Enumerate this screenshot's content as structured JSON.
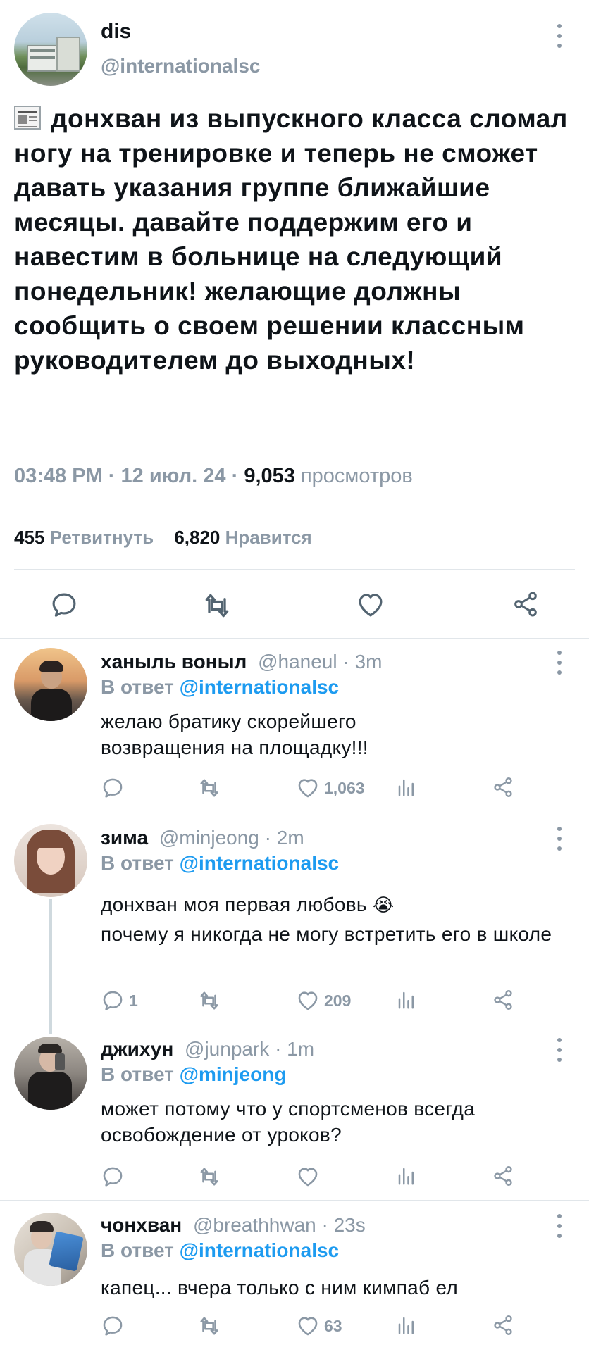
{
  "main_tweet": {
    "display_name": "dis",
    "handle": "@internationalsc",
    "text": "донхван из выпускного класса сломал ногу на тренировке и теперь не сможет давать указания группе ближайшие месяцы. давайте поддержим его и навестим в больнице на следующий понедельник! желающие должны сообщить о своем решении классным руководителем до выходных!",
    "time": "03:48 PM",
    "sep1": "·",
    "date": "12 июл. 24",
    "sep2": "·",
    "views": "9,053",
    "views_label": "просмотров",
    "retweets": "455",
    "retweets_label": "Ретвитнуть",
    "likes": "6,820",
    "likes_label": "Нравится",
    "icons": [
      "newspaper-emoji",
      "reply-icon",
      "retweet-icon",
      "like-icon",
      "share-icon"
    ]
  },
  "replies": [
    {
      "display_name": "ханыль воныл",
      "handle": "@haneul",
      "time": "· 3m",
      "reply_prefix": "В ответ",
      "reply_to": "@internationalsc",
      "text": "желаю братику скорейшего возвращения на площадку!!!",
      "reply_count": "",
      "like_count": "1,063"
    },
    {
      "display_name": "зима",
      "handle": "@minjeong",
      "time": "· 2m",
      "reply_prefix": "В ответ",
      "reply_to": "@internationalsc",
      "text_line1": "донхван моя первая любовь",
      "emoji": "😭",
      "text_line2": "почему я никогда не могу встретить его в школе",
      "reply_count": "1",
      "like_count": "209"
    },
    {
      "display_name": "джихун",
      "handle": "@junpark",
      "time": "· 1m",
      "reply_prefix": "В ответ",
      "reply_to": "@minjeong",
      "text": "может потому что у спортсменов всегда освобождение от уроков?",
      "reply_count": "",
      "like_count": ""
    },
    {
      "display_name": "чонхван",
      "handle": "@breathhwan",
      "time": "· 23s",
      "reply_prefix": "В ответ",
      "reply_to": "@internationalsc",
      "text": "капец... вчера только с ним кимпаб ел",
      "reply_count": "",
      "like_count": "63"
    }
  ],
  "colors": {
    "text": "#0f1419",
    "secondary": "#8b98a5",
    "link": "#1d9bf0",
    "divider": "#e1e6ea"
  }
}
